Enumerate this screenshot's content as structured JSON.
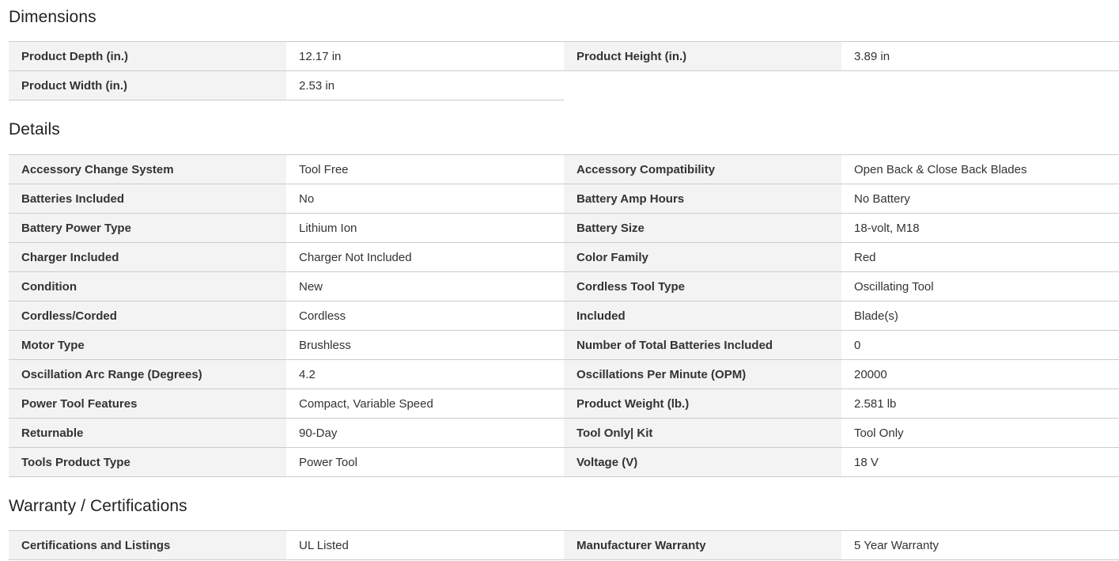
{
  "sections": {
    "dimensions": {
      "title": "Dimensions",
      "rows": [
        [
          {
            "label": "Product Depth (in.)",
            "value": "12.17 in"
          },
          {
            "label": "Product Height (in.)",
            "value": "3.89 in"
          }
        ],
        [
          {
            "label": "Product Width (in.)",
            "value": "2.53 in"
          }
        ]
      ]
    },
    "details": {
      "title": "Details",
      "rows": [
        [
          {
            "label": "Accessory Change System",
            "value": "Tool Free"
          },
          {
            "label": "Accessory Compatibility",
            "value": "Open Back & Close Back Blades"
          }
        ],
        [
          {
            "label": "Batteries Included",
            "value": "No"
          },
          {
            "label": "Battery Amp Hours",
            "value": "No Battery"
          }
        ],
        [
          {
            "label": "Battery Power Type",
            "value": "Lithium Ion"
          },
          {
            "label": "Battery Size",
            "value": "18-volt, M18"
          }
        ],
        [
          {
            "label": "Charger Included",
            "value": "Charger Not Included"
          },
          {
            "label": "Color Family",
            "value": "Red"
          }
        ],
        [
          {
            "label": "Condition",
            "value": "New"
          },
          {
            "label": "Cordless Tool Type",
            "value": "Oscillating Tool"
          }
        ],
        [
          {
            "label": "Cordless/Corded",
            "value": "Cordless"
          },
          {
            "label": "Included",
            "value": "Blade(s)"
          }
        ],
        [
          {
            "label": "Motor Type",
            "value": "Brushless"
          },
          {
            "label": "Number of Total Batteries Included",
            "value": "0"
          }
        ],
        [
          {
            "label": "Oscillation Arc Range (Degrees)",
            "value": "4.2"
          },
          {
            "label": "Oscillations Per Minute (OPM)",
            "value": "20000"
          }
        ],
        [
          {
            "label": "Power Tool Features",
            "value": "Compact, Variable Speed"
          },
          {
            "label": "Product Weight (lb.)",
            "value": "2.581 lb"
          }
        ],
        [
          {
            "label": "Returnable",
            "value": "90-Day"
          },
          {
            "label": "Tool Only| Kit",
            "value": "Tool Only"
          }
        ],
        [
          {
            "label": "Tools Product Type",
            "value": "Power Tool"
          },
          {
            "label": "Voltage (V)",
            "value": "18 V"
          }
        ]
      ]
    },
    "warranty": {
      "title": "Warranty / Certifications",
      "rows": [
        [
          {
            "label": "Certifications and Listings",
            "value": "UL Listed"
          },
          {
            "label": "Manufacturer Warranty",
            "value": "5 Year Warranty"
          }
        ]
      ]
    }
  },
  "colors": {
    "label_bg": "#f3f3f3",
    "border": "#cccccc",
    "text": "#333333"
  }
}
